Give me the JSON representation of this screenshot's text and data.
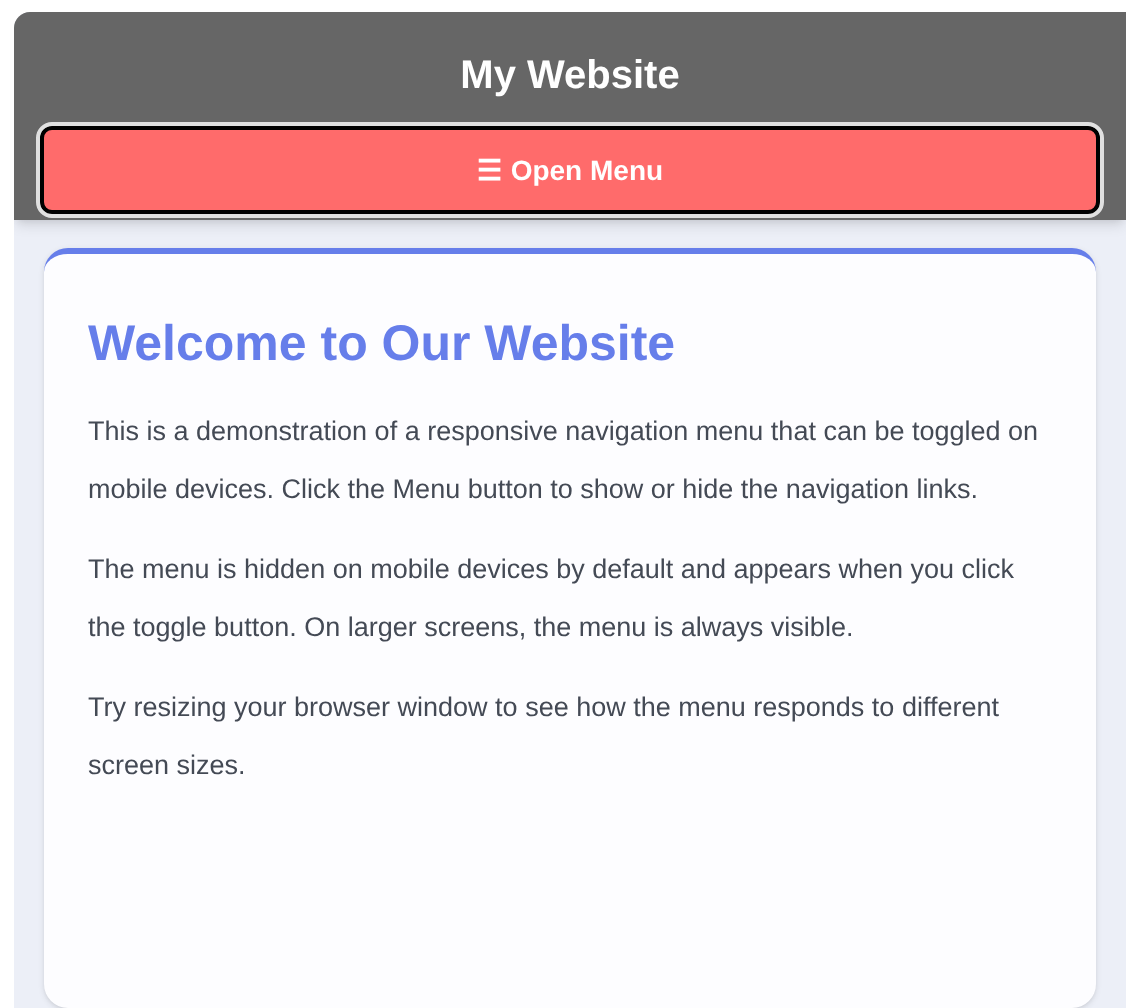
{
  "header": {
    "title": "My Website",
    "menu_button": {
      "icon": "☰",
      "label": "Open Menu",
      "expanded": false
    }
  },
  "main": {
    "heading": "Welcome to Our Website",
    "paragraphs": [
      "This is a demonstration of a responsive navigation menu that can be toggled on mobile devices. Click the Menu button to show or hide the navigation links.",
      "The menu is hidden on mobile devices by default and appears when you click the toggle button. On larger screens, the menu is always visible.",
      "Try resizing your browser window to see how the menu responds to different screen sizes."
    ]
  }
}
